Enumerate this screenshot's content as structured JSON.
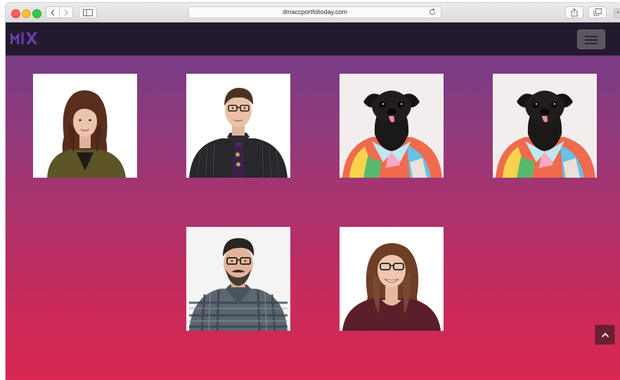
{
  "browser": {
    "url": "dmaccportfolioday.com",
    "plus_label": "+"
  },
  "site": {
    "logo_text": "MIX",
    "logo_color": "#6a3fa8"
  },
  "people": [
    {
      "name": "woman-brown-hair",
      "kind": "photo"
    },
    {
      "name": "man-glasses-tie",
      "kind": "photo"
    },
    {
      "name": "pug-in-shirt",
      "kind": "photo"
    },
    {
      "name": "pug-in-shirt",
      "kind": "photo"
    },
    {
      "name": "man-beard-plaid",
      "kind": "photo"
    },
    {
      "name": "woman-glasses-smiling",
      "kind": "photo"
    }
  ],
  "colors": {
    "navbar": "#231a2e",
    "gradient_top": "#773c85",
    "gradient_bottom": "#d82853",
    "scroll_button": "#6b1f30"
  }
}
